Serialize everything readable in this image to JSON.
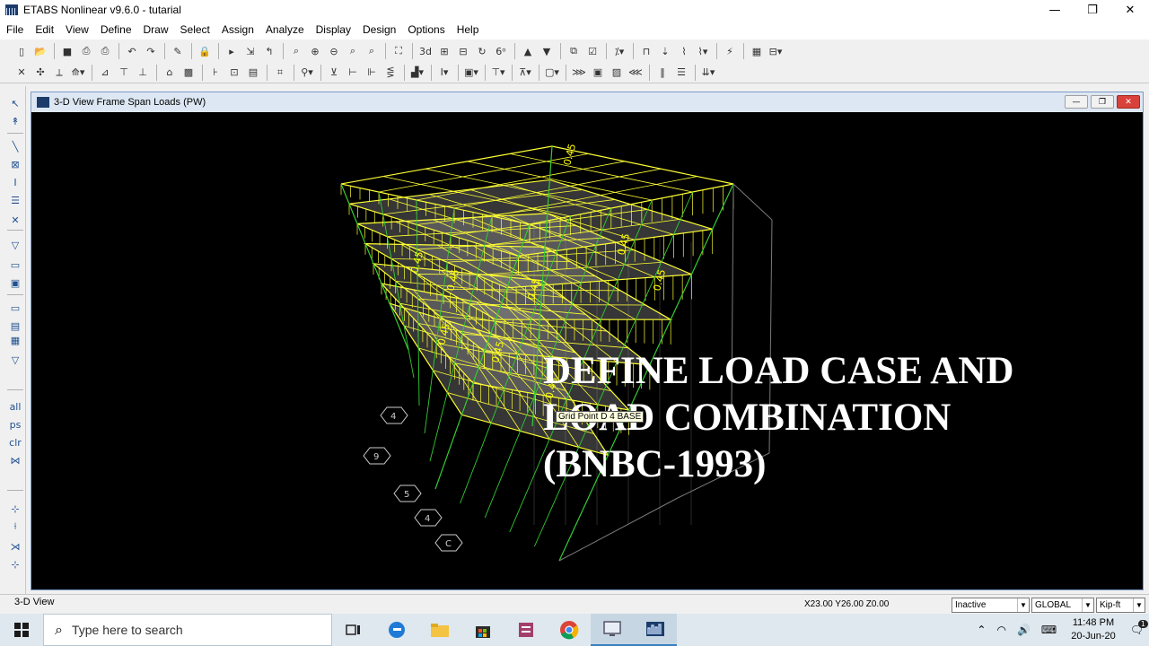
{
  "app": {
    "title": "ETABS Nonlinear v9.6.0 - tutarial"
  },
  "window_controls": {
    "minimize": "—",
    "maximize": "❐",
    "close": "✕"
  },
  "menu": [
    "File",
    "Edit",
    "View",
    "Define",
    "Draw",
    "Select",
    "Assign",
    "Analyze",
    "Display",
    "Design",
    "Options",
    "Help"
  ],
  "view": {
    "title": "3-D View  Frame Span Loads (PW)",
    "controls": {
      "minimize": "—",
      "restore": "❐",
      "close": "✕"
    },
    "overlay_text": "DEFINE LOAD CASE AND\nLOAD COMBINATION\n(BNBC-1993)",
    "tooltip": "Grid Point D 4 BASE",
    "load_value": "0.45",
    "grid_bubbles": [
      "4",
      "9",
      "5",
      "4",
      "C"
    ]
  },
  "status": {
    "left": "3-D View",
    "coords": "X23.00  Y26.00  Z0.00",
    "dropdowns": {
      "state": "Inactive",
      "coord_system": "GLOBAL",
      "units": "Kip-ft"
    }
  },
  "taskbar": {
    "search_placeholder": "Type here to search",
    "time": "11:48 PM",
    "date": "20-Jun-20",
    "notification_count": "1"
  },
  "colors": {
    "frame": "#ffff33",
    "grid": "#2a2a2a",
    "column": "#33cc33",
    "slab": "#9a9a9a",
    "load_text": "#ffff00"
  }
}
